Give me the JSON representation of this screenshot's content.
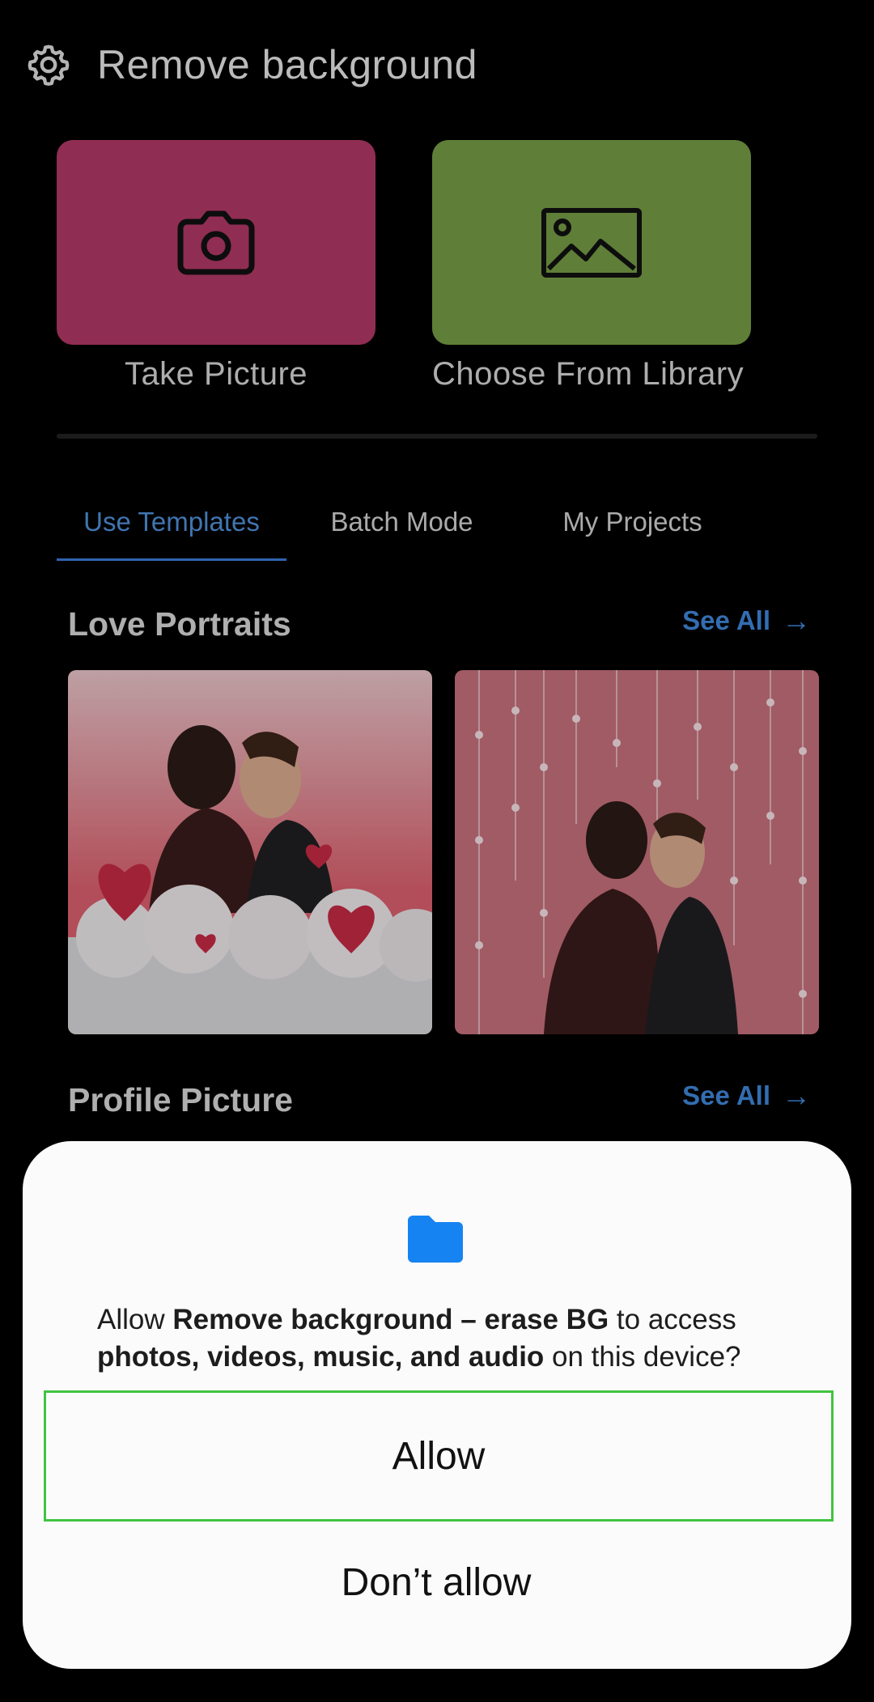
{
  "header": {
    "title": "Remove background",
    "settings_icon": "gear-icon"
  },
  "actions": {
    "take_picture": {
      "label": "Take Picture",
      "icon": "camera-icon",
      "color": "#b03865"
    },
    "choose_library": {
      "label": "Choose From Library",
      "icon": "image-icon",
      "color": "#749a45"
    }
  },
  "tabs": [
    {
      "label": "Use Templates",
      "active": true
    },
    {
      "label": "Batch Mode",
      "active": false
    },
    {
      "label": "My Projects",
      "active": false
    }
  ],
  "sections": [
    {
      "title": "Love Portraits",
      "see_all": "See All"
    },
    {
      "title": "Profile Picture",
      "see_all": "See All"
    }
  ],
  "permission_dialog": {
    "icon": "folder-icon",
    "text_allow": "Allow",
    "app_name": "Remove background – erase BG",
    "text_to_access": "to access",
    "media_types": "photos, videos, music, and audio",
    "text_on_device": "on this device?",
    "allow_label": "Allow",
    "deny_label": "Don’t allow"
  },
  "colors": {
    "accent": "#3f86d8",
    "dialog_bg": "#fbfbfb",
    "focus_border": "#41c441"
  }
}
